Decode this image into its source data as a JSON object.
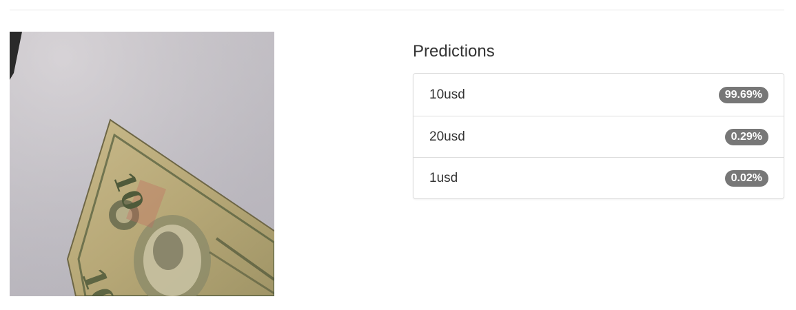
{
  "predictions": {
    "title": "Predictions",
    "items": [
      {
        "label": "10usd",
        "score": "99.69%"
      },
      {
        "label": "20usd",
        "score": "0.29%"
      },
      {
        "label": "1usd",
        "score": "0.02%"
      }
    ]
  },
  "photo": {
    "subject": "ten-dollar-bill-photo"
  },
  "colors": {
    "badge": "#777777",
    "border": "#dddddd",
    "text": "#333333"
  }
}
